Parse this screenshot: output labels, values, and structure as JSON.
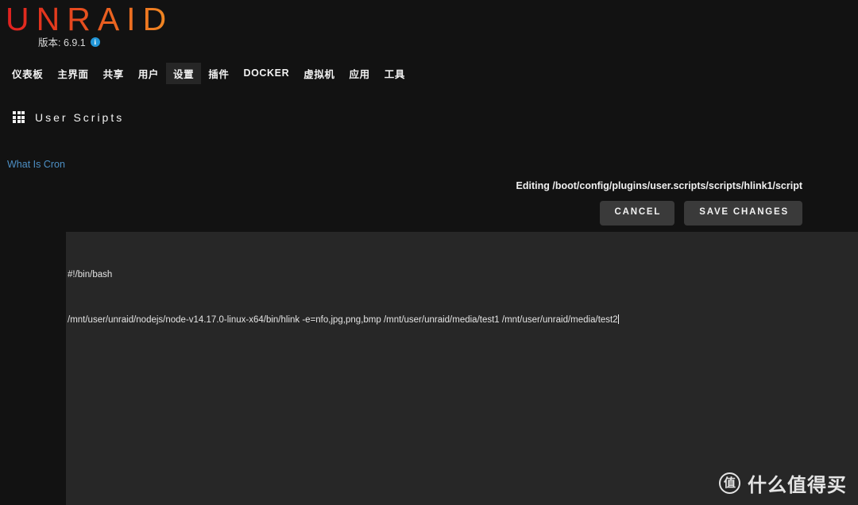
{
  "header": {
    "logo_text": "UNRAID",
    "version_label": "版本: 6.9.1",
    "info_icon_glyph": "i"
  },
  "nav": {
    "items": [
      {
        "label": "仪表板",
        "active": false
      },
      {
        "label": "主界面",
        "active": false
      },
      {
        "label": "共享",
        "active": false
      },
      {
        "label": "用户",
        "active": false
      },
      {
        "label": "设置",
        "active": true
      },
      {
        "label": "插件",
        "active": false
      },
      {
        "label": "DOCKER",
        "active": false
      },
      {
        "label": "虚拟机",
        "active": false
      },
      {
        "label": "应用",
        "active": false
      },
      {
        "label": "工具",
        "active": false
      }
    ]
  },
  "page": {
    "title": "User Scripts",
    "title_icon": "grid-icon",
    "cron_link_label": "What Is Cron",
    "editing_label": "Editing /boot/config/plugins/user.scripts/scripts/hlink1/script"
  },
  "buttons": {
    "cancel_label": "CANCEL",
    "save_label": "SAVE CHANGES"
  },
  "editor": {
    "lines": [
      "#!/bin/bash",
      "/mnt/user/unraid/nodejs/node-v14.17.0-linux-x64/bin/hlink -e=nfo,jpg,png,bmp /mnt/user/unraid/media/test1 /mnt/user/unraid/media/test2"
    ],
    "caret_line_index": 1
  },
  "watermark": {
    "badge_glyph": "值",
    "text": "什么值得买"
  },
  "colors": {
    "page_background": "#121212",
    "editor_background": "#272727",
    "button_background": "#3a3a3a",
    "link_blue": "#4d8fc4",
    "logo_gradient_start": "#e02020",
    "logo_gradient_end": "#f08a22",
    "info_icon_blue": "#2196d8"
  }
}
